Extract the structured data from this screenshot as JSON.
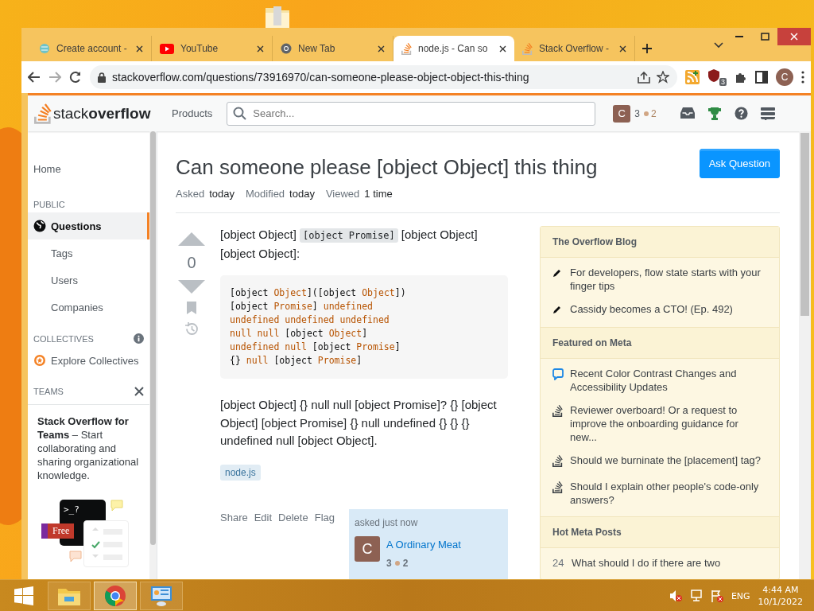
{
  "browser": {
    "tabs": [
      {
        "kind": "account",
        "title": "Create account -",
        "selected": false
      },
      {
        "kind": "youtube",
        "title": "YouTube",
        "selected": false
      },
      {
        "kind": "chrome",
        "title": "New Tab",
        "selected": false
      },
      {
        "kind": "stackoverflow",
        "title": "node.js - Can so",
        "selected": true
      },
      {
        "kind": "stackoverflow",
        "title": "Stack Overflow -",
        "selected": false
      }
    ],
    "url": "stackoverflow.com/questions/73916970/can-someone-please-object-object-this-thing",
    "extension_count": "3",
    "profile_initial": "C"
  },
  "site_header": {
    "logo": "stack**overflow**",
    "products": "Products",
    "search": {
      "placeholder": "Search..."
    },
    "user": {
      "initial": "C",
      "reputation": "3",
      "bronze": "2"
    }
  },
  "sidebar": {
    "items": [
      {
        "kind": "top",
        "label": "Home",
        "selected": false
      },
      {
        "kind": "heading",
        "label": "PUBLIC"
      },
      {
        "kind": "primary",
        "label": "Questions",
        "selected": true
      },
      {
        "kind": "sub",
        "label": "Tags",
        "selected": false
      },
      {
        "kind": "sub",
        "label": "Users",
        "selected": false
      },
      {
        "kind": "sub",
        "label": "Companies",
        "selected": false
      },
      {
        "kind": "heading-info",
        "label": "COLLECTIVES"
      },
      {
        "kind": "collective",
        "label": "Explore Collectives",
        "selected": false
      },
      {
        "kind": "heading-close",
        "label": "TEAMS"
      }
    ],
    "promo": {
      "text": "**Stack Overflow for Teams** – Start collaborating and sharing organizational knowledge.",
      "prompt": ">_?",
      "badge": "Free"
    }
  },
  "question": {
    "title": "Can someone please [object Object] this thing",
    "ask_button": "Ask Question",
    "meta": [
      {
        "label": "Asked",
        "value": "today"
      },
      {
        "label": "Modified",
        "value": "today"
      },
      {
        "label": "Viewed",
        "value": "1 time"
      }
    ],
    "votes": "0",
    "intro": [
      {
        "kind": "text",
        "text": "[object Object] "
      },
      {
        "kind": "code",
        "text": "[object Promise]"
      },
      {
        "kind": "text",
        "text": " [object Object] [object Object]:"
      }
    ],
    "code_lines": [
      [
        {
          "kind": "plain",
          "text": "[object "
        },
        {
          "kind": "literal",
          "text": "Object"
        },
        {
          "kind": "plain",
          "text": "]([object "
        },
        {
          "kind": "literal",
          "text": "Object"
        },
        {
          "kind": "plain",
          "text": "])"
        }
      ],
      [
        {
          "kind": "plain",
          "text": "[object "
        },
        {
          "kind": "literal",
          "text": "Promise"
        },
        {
          "kind": "plain",
          "text": "] "
        },
        {
          "kind": "literal",
          "text": "undefined"
        }
      ],
      [
        {
          "kind": "literal",
          "text": "undefined undefined undefined"
        }
      ],
      [
        {
          "kind": "literal",
          "text": "null null"
        },
        {
          "kind": "plain",
          "text": " [object "
        },
        {
          "kind": "literal",
          "text": "Object"
        },
        {
          "kind": "plain",
          "text": "]"
        }
      ],
      [
        {
          "kind": "literal",
          "text": "undefined null"
        },
        {
          "kind": "plain",
          "text": " [object "
        },
        {
          "kind": "literal",
          "text": "Promise"
        },
        {
          "kind": "plain",
          "text": "]"
        }
      ],
      [
        {
          "kind": "plain",
          "text": "{}"
        },
        {
          "kind": "literal",
          "text": " null"
        },
        {
          "kind": "plain",
          "text": " [object "
        },
        {
          "kind": "literal",
          "text": "Promise"
        },
        {
          "kind": "plain",
          "text": "]"
        }
      ]
    ],
    "body": "[object Object] {} null null [object Promise]? {} [object Object] [object Promise] {} null undefined {} {} {} undefined null [object Object].",
    "tags": [
      "node.js"
    ],
    "actions": [
      "Share",
      "Edit",
      "Delete",
      "Flag"
    ],
    "author": {
      "asked": "asked just now",
      "initial": "C",
      "name": "A Ordinary Meat",
      "reputation": "3",
      "bronze": "2"
    }
  },
  "right_sidebar": [
    {
      "title": "The Overflow Blog",
      "items": [
        {
          "kind": "pencil",
          "text": "For developers, flow state starts with your finger tips"
        },
        {
          "kind": "pencil",
          "text": "Cassidy becomes a CTO! (Ep. 492)"
        }
      ]
    },
    {
      "title": "Featured on Meta",
      "items": [
        {
          "kind": "chat",
          "text": "Recent Color Contrast Changes and Accessibility Updates"
        },
        {
          "kind": "meta",
          "text": "Reviewer overboard! Or a request to improve the onboarding guidance for new..."
        },
        {
          "kind": "meta",
          "text": "Should we burninate the [placement] tag?"
        },
        {
          "kind": "meta",
          "text": "Should I explain other people's code-only answers?"
        }
      ]
    },
    {
      "title": "Hot Meta Posts",
      "items": [
        {
          "kind": "count",
          "count": "24",
          "text": "What should I do if there are two"
        }
      ]
    }
  ],
  "taskbar": {
    "apps": [
      {
        "kind": "explorer",
        "selected": false
      },
      {
        "kind": "chrome",
        "selected": true
      },
      {
        "kind": "control-panel",
        "selected": false
      }
    ],
    "language": "ENG",
    "time": "4:44 AM",
    "date": "10/1/2022"
  }
}
